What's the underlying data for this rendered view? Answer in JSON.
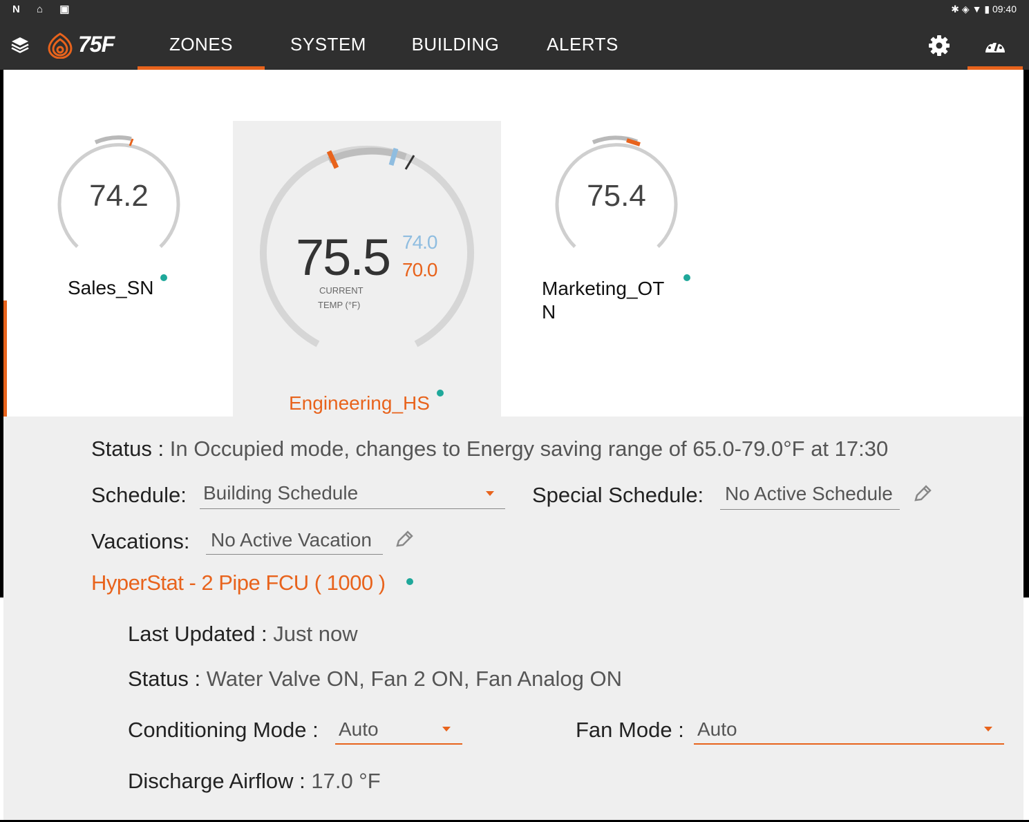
{
  "statusbar": {
    "left_icons": "N ⌂ ▣",
    "time": "09:40"
  },
  "nav": {
    "logo_text": "75F",
    "tabs": [
      {
        "label": "ZONES",
        "active": true
      },
      {
        "label": "SYSTEM",
        "active": false
      },
      {
        "label": "BUILDING",
        "active": false
      },
      {
        "label": "ALERTS",
        "active": false
      }
    ]
  },
  "zones": [
    {
      "name": "Sales_SN",
      "temp": "74.2",
      "online": true,
      "selected": false
    },
    {
      "name": "Engineering_HS",
      "temp": "75.5",
      "cooling_setpoint": "74.0",
      "heating_setpoint": "70.0",
      "temp_caption_1": "CURRENT",
      "temp_caption_2": "TEMP (°F)",
      "online": true,
      "selected": true
    },
    {
      "name_line1": "Marketing_OT",
      "name_line2": "N",
      "temp": "75.4",
      "online": true,
      "selected": false
    }
  ],
  "detail": {
    "status_label": "Status :",
    "status_value": "In Occupied mode, changes to Energy saving range of 65.0-79.0°F at 17:30",
    "schedule_label": "Schedule:",
    "schedule_value": "Building Schedule",
    "special_schedule_label": "Special Schedule:",
    "special_schedule_value": "No Active Schedule",
    "vacations_label": "Vacations:",
    "vacations_value": "No Active Vacation",
    "equipment_title": "HyperStat -  2 Pipe FCU ( 1000 )",
    "last_updated_label": "Last Updated :",
    "last_updated_value": "Just now",
    "equip_status_label": "Status :",
    "equip_status_value": "Water Valve ON, Fan 2 ON, Fan Analog ON",
    "conditioning_mode_label": "Conditioning Mode :",
    "conditioning_mode_value": "Auto",
    "fan_mode_label": "Fan Mode :",
    "fan_mode_value": "Auto",
    "discharge_airflow_label": "Discharge Airflow :",
    "discharge_airflow_value": "17.0 °F"
  },
  "colors": {
    "accent": "#e8631c",
    "online": "#1fa89a",
    "cooling": "#8fbde0",
    "appbar": "#2f2f2f"
  }
}
